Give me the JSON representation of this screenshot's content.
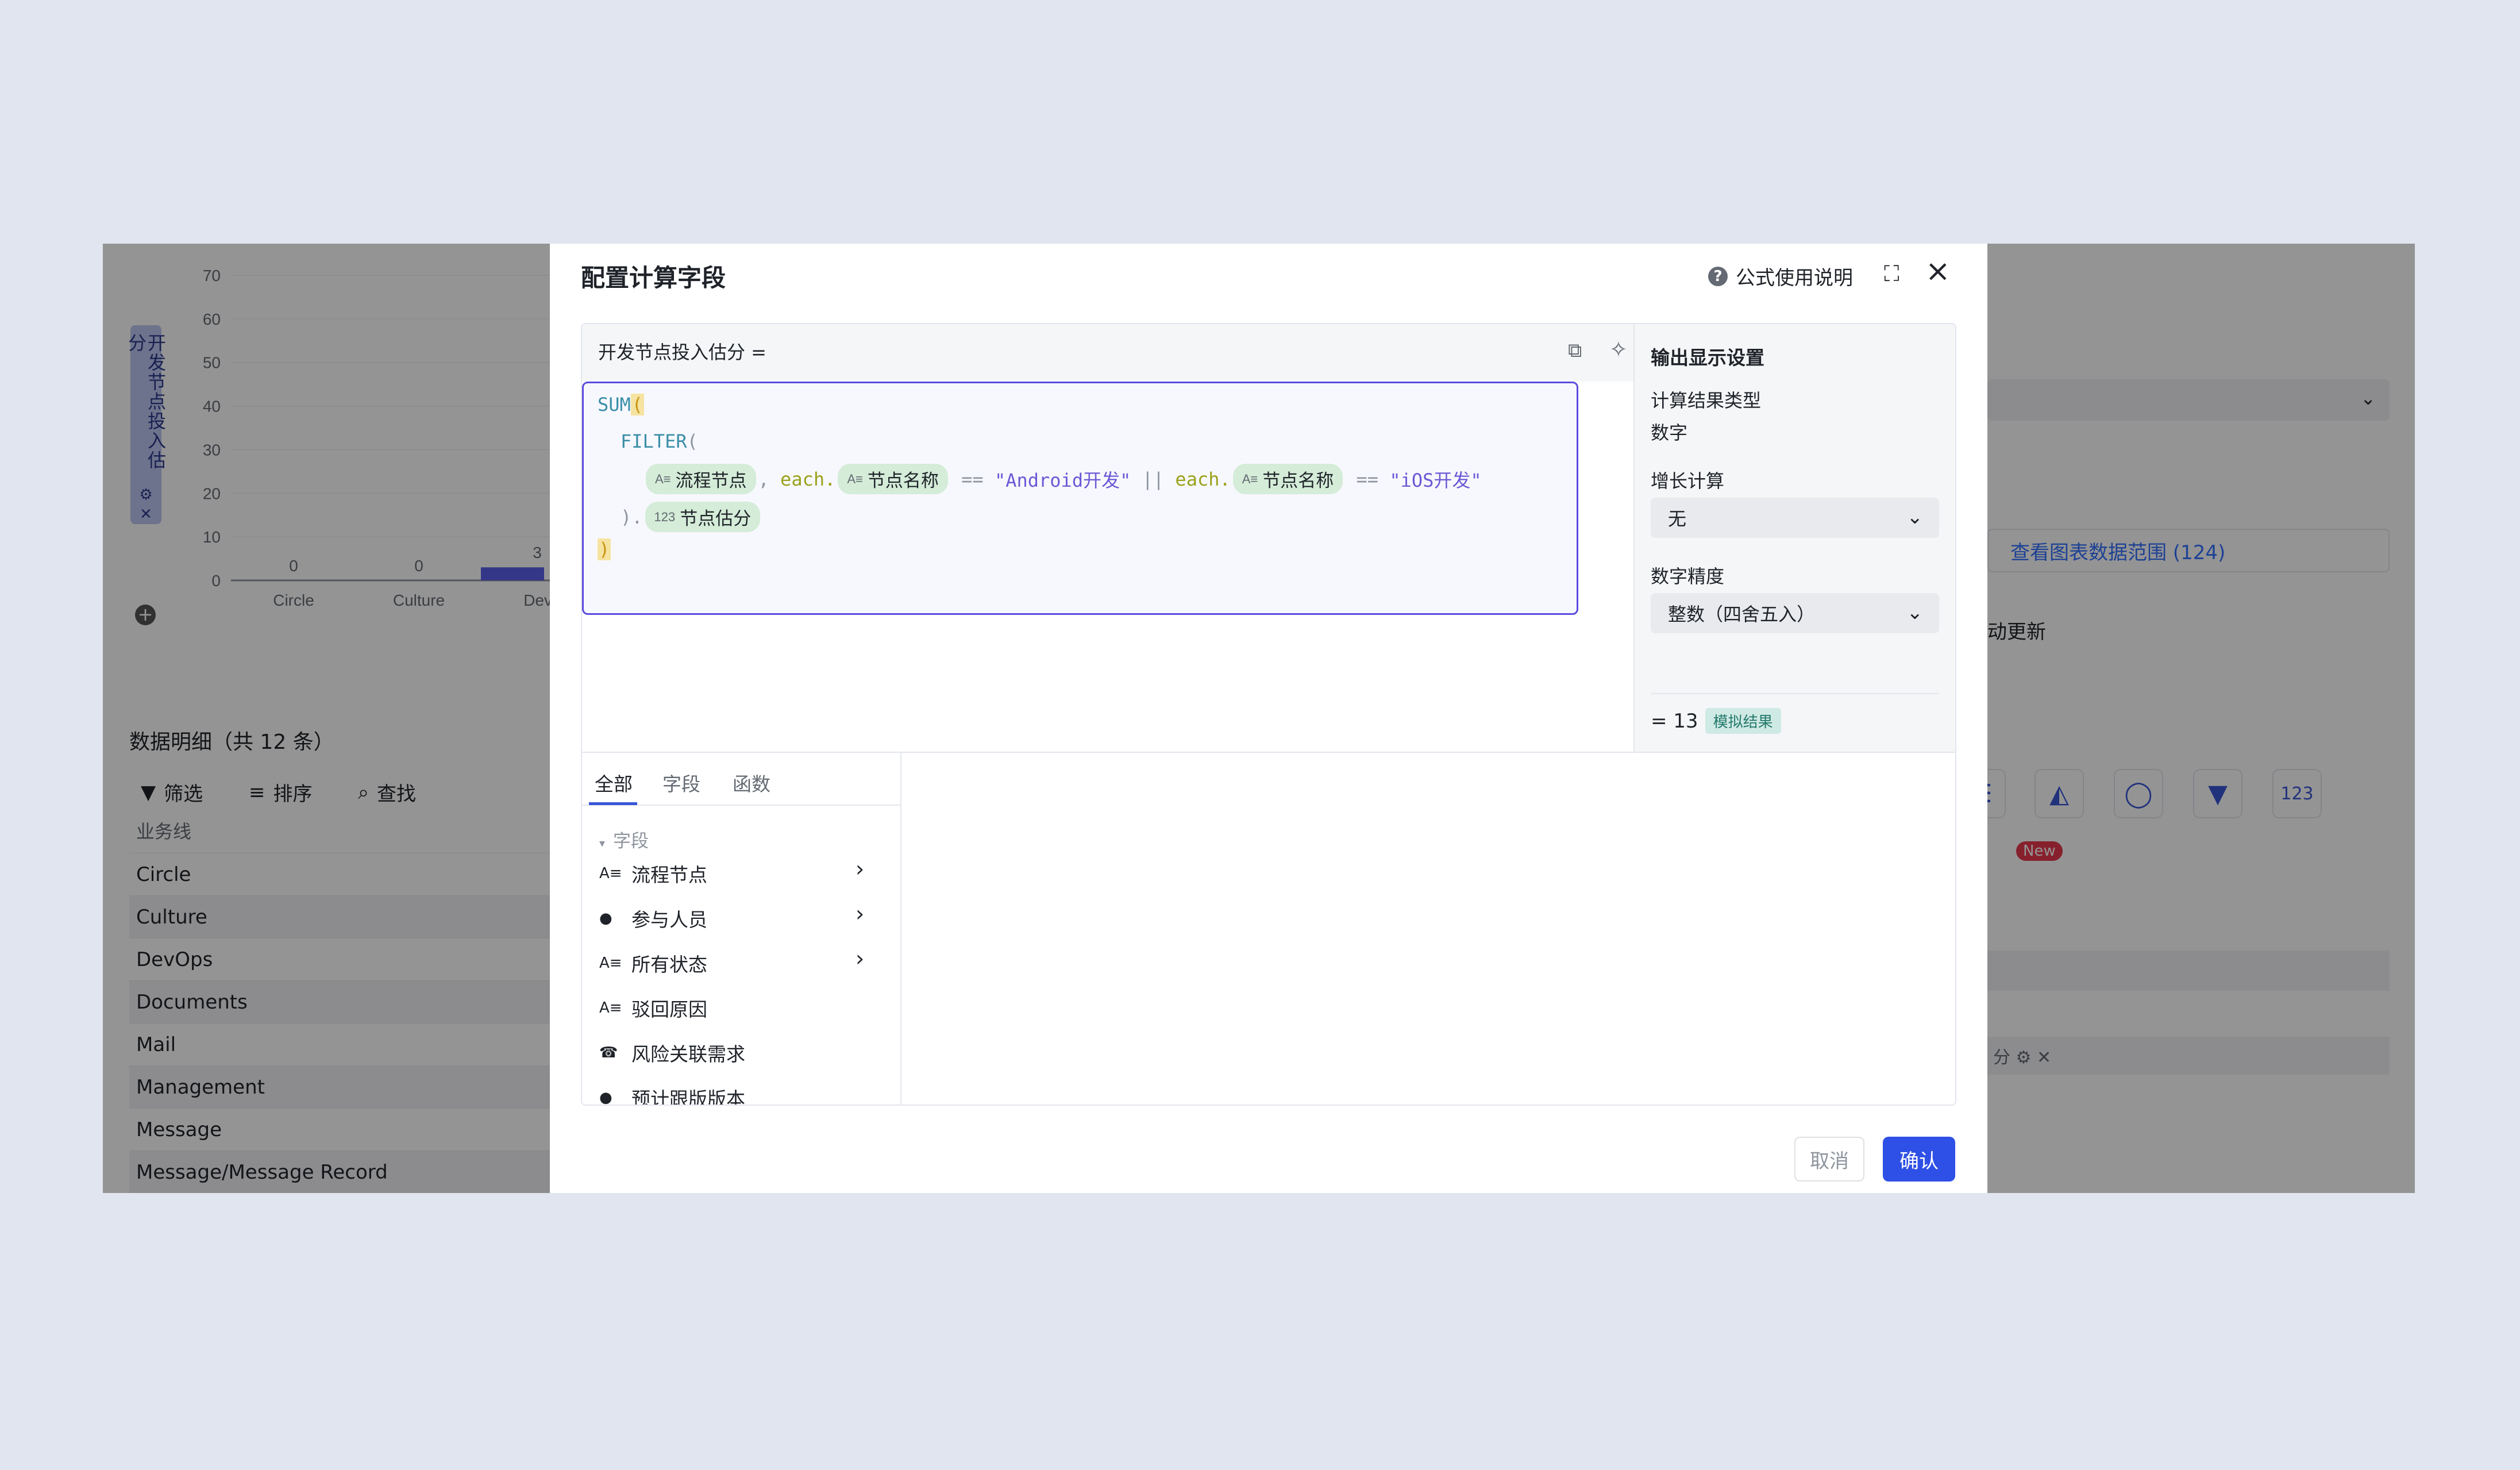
{
  "background": {
    "chart": {
      "yaxis_vertical_label": "开发节点投入估分",
      "yticks": [
        "70",
        "60",
        "50",
        "40",
        "30",
        "20",
        "10",
        "0"
      ],
      "categories": [
        "Circle",
        "Culture",
        "DevO"
      ],
      "value_labels": [
        "0",
        "0",
        "3"
      ]
    },
    "chart_data": {
      "type": "bar",
      "categories": [
        "Circle",
        "Culture",
        "DevO"
      ],
      "values": [
        0,
        0,
        3
      ],
      "ylabel": "开发节点投入估分",
      "ylim": [
        0,
        70
      ]
    },
    "table": {
      "title": "数据明细（共 12 条）",
      "toolbar": {
        "filter": "筛选",
        "sort": "排序",
        "find": "查找"
      },
      "column": "业务线",
      "rows": [
        "Circle",
        "Culture",
        "DevOps",
        "Documents",
        "Mail",
        "Management",
        "Message",
        "Message/Message Record"
      ]
    },
    "right_panel": {
      "data_range_link": "查看图表数据范围 (124)",
      "auto_update": "动更新",
      "new_badge": "New",
      "field_tag": "分 ⚙ ✕"
    }
  },
  "modal": {
    "title": "配置计算字段",
    "help_label": "公式使用说明",
    "field_name": "开发节点投入估分 =",
    "code": {
      "line1": "SUM",
      "line2": "FILTER",
      "chip_flow_node": "流程节点",
      "comma": ",",
      "each": "each.",
      "chip_node_name": "节点名称",
      "eq": "==",
      "str_android": "\"Android开发\"",
      "or": "||",
      "str_ios": "\"iOS开发\"",
      "close_dot": ").",
      "chip_node_score": "节点估分"
    },
    "output": {
      "title": "输出显示设置",
      "type_label": "计算结果类型",
      "type_value": "数字",
      "growth_label": "增长计算",
      "growth_value": "无",
      "precision_label": "数字精度",
      "precision_value": "整数（四舍五入）",
      "result": "= 13",
      "result_badge": "模拟结果"
    },
    "tabs": [
      "全部",
      "字段",
      "函数"
    ],
    "group_label": "字段",
    "fields": [
      "流程节点",
      "参与人员",
      "所有状态",
      "驳回原因",
      "风险关联需求",
      "预计跟版版本"
    ],
    "buttons": {
      "cancel": "取消",
      "confirm": "确认"
    }
  }
}
